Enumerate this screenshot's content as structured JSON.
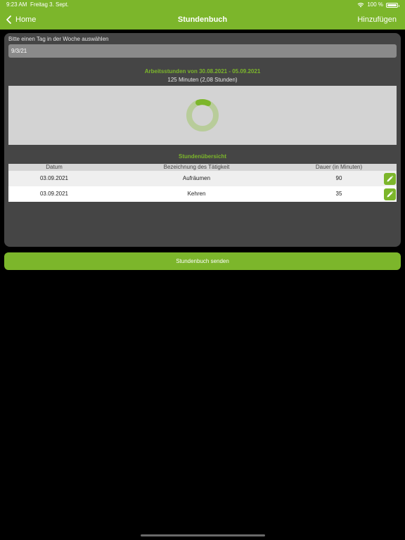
{
  "status_bar": {
    "time": "9:23 AM",
    "date": "Freitag 3. Sept.",
    "battery": "100 %"
  },
  "nav": {
    "back_label": "Home",
    "title": "Stundenbuch",
    "add_label": "Hinzufügen"
  },
  "day_picker": {
    "label": "Bitte einen Tag in der Woche auswählen",
    "value": "9/3/21"
  },
  "week": {
    "range": "Arbeitsstunden von 30.08.2021 - 05.09.2021",
    "total": "125 Minuten (2,08 Stunden)"
  },
  "overview": {
    "title": "Stundenübersicht",
    "columns": [
      "Datum",
      "Bezeichnung des Tätigkeit",
      "Dauer (in Minuten)"
    ],
    "rows": [
      {
        "date": "03.09.2021",
        "activity": "Aufräumen",
        "duration": "90"
      },
      {
        "date": "03.09.2021",
        "activity": "Kehren",
        "duration": "35"
      }
    ]
  },
  "send_label": "Stundenbuch senden",
  "colors": {
    "accent": "#7cb62b",
    "card": "#454545",
    "background": "#000000"
  }
}
